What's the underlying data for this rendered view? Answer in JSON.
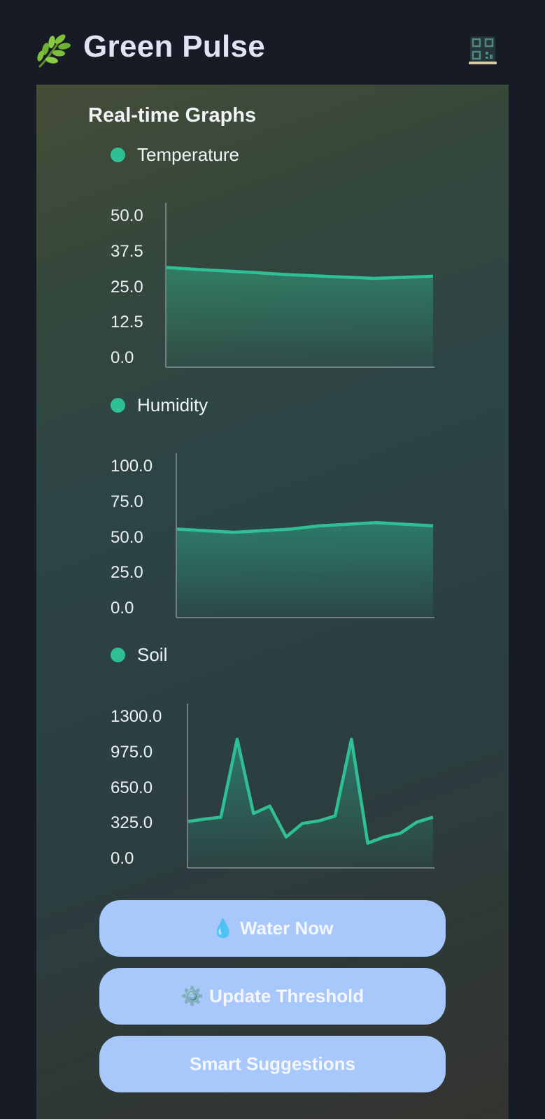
{
  "app": {
    "title": "Green Pulse",
    "logo_icon": "herb-leaf-icon",
    "qr_icon": "qr-scan-icon"
  },
  "graphs": {
    "section_title": "Real-time Graphs"
  },
  "colors": {
    "accent": "#2fbf95",
    "button_bg": "#a8c7fa",
    "app_bg": "#161b25"
  },
  "chart_data": [
    {
      "type": "area",
      "series": [
        {
          "name": "Temperature",
          "values": [
            31.0,
            30.4,
            29.9,
            29.4,
            28.8,
            28.4,
            28.0,
            27.6,
            27.9,
            28.3
          ]
        }
      ],
      "y_ticks": [
        "50.0",
        "37.5",
        "25.0",
        "12.5",
        "0.0"
      ],
      "ylim": [
        0,
        50
      ],
      "grid": false
    },
    {
      "type": "area",
      "series": [
        {
          "name": "Humidity",
          "values": [
            55.0,
            54.0,
            53.0,
            54.0,
            55.0,
            57.0,
            58.0,
            59.0,
            58.0,
            57.0
          ]
        }
      ],
      "y_ticks": [
        "100.0",
        "75.0",
        "50.0",
        "25.0",
        "0.0"
      ],
      "ylim": [
        0,
        100
      ],
      "grid": false
    },
    {
      "type": "area",
      "series": [
        {
          "name": "Soil",
          "values": [
            375,
            395,
            410,
            1040,
            440,
            500,
            250,
            360,
            380,
            420,
            1040,
            200,
            250,
            280,
            370,
            410
          ]
        }
      ],
      "y_ticks": [
        "1300.0",
        "975.0",
        "650.0",
        "325.0",
        "0.0"
      ],
      "ylim": [
        0,
        1300
      ],
      "grid": false
    }
  ],
  "actions": {
    "water_now": {
      "emoji": "💧",
      "label": "Water Now"
    },
    "update_threshold": {
      "emoji": "⚙️",
      "label": "Update Threshold"
    },
    "smart_suggestions": {
      "label": "Smart Suggestions"
    }
  }
}
